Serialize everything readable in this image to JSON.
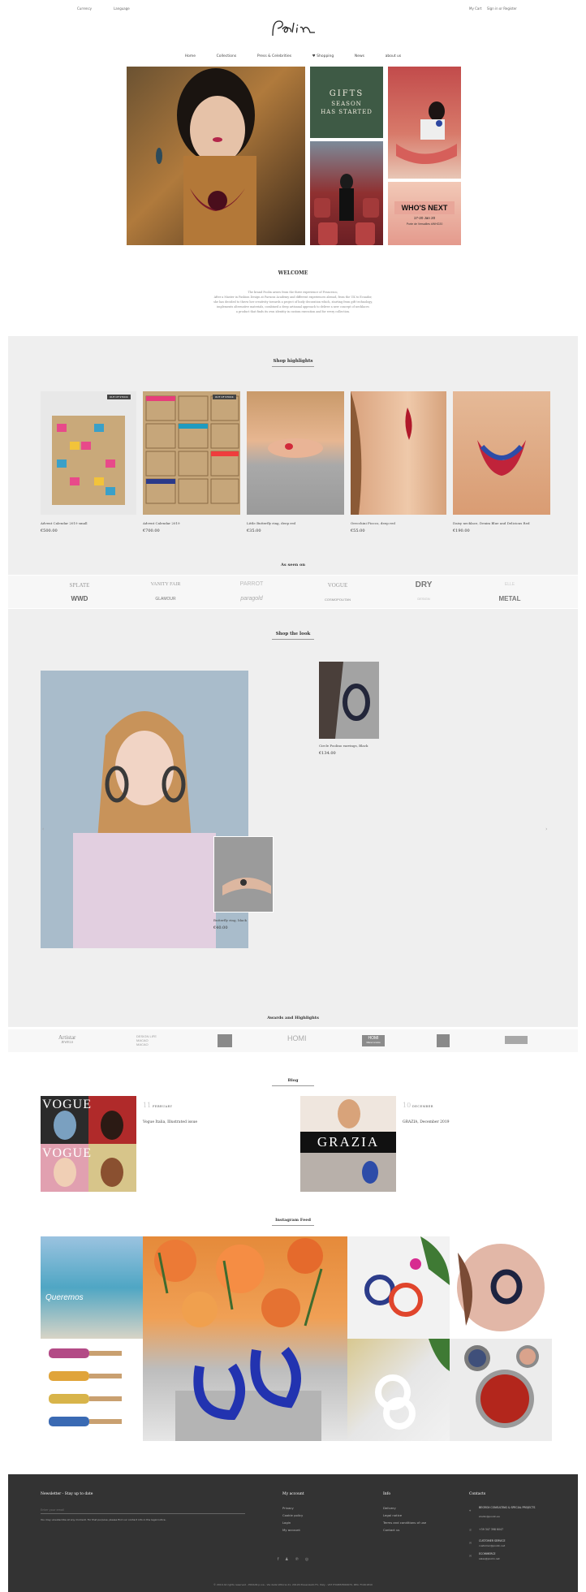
{
  "topbar": {
    "left1": "Currency",
    "left2": "Language",
    "right1": "My Cart",
    "right2": "Sign in or Register"
  },
  "logo": "Poolin",
  "nav": [
    "Home",
    "Collections",
    "Press & Celebrities",
    "♥ Shopping",
    "News",
    "about us"
  ],
  "hero": {
    "gifts_line1": "GIFTS",
    "gifts_line2": "SEASON",
    "gifts_line3": "HAS STARTED",
    "whats_next": "WHO'S NEXT",
    "whats_dates": "17-20 Jan 20",
    "whats_place": "Porte de Versailles #WHO20"
  },
  "welcome": {
    "title": "WELCOME",
    "lines": [
      "The brand Poolin arises from the three experience of Francesco,",
      "After a Master in Fashion Design at Parsons Academy and different experiences abroad, from the UK to Ecuador,",
      "she has decided to throw her creativity towards a project of body decoration which, starting from gift technology,",
      "implements alternative materials, combined a deep artisanal approach to deliver a new concept of necklaces",
      "a product that finds its own identity in custom execution and for every collection."
    ]
  },
  "shop_highlights": {
    "title": "Shop highlights",
    "badge": "OUT OF STOCK",
    "products": [
      {
        "name": "Advent Calendar 2019 small",
        "price": "€500.00"
      },
      {
        "name": "Advent Calendar 2019",
        "price": "€700.00"
      },
      {
        "name": "Little Butterfly ring, deep red",
        "price": "€35.00"
      },
      {
        "name": "Orecchini Fiocco, deep red",
        "price": "€55.00"
      },
      {
        "name": "Daisy necklace, Denim Blue and Delicious Red",
        "price": "€190.00"
      }
    ]
  },
  "as_seen_on": {
    "title": "As seen on",
    "row1": [
      "SPLATE",
      "VANITY FAIR",
      "PARROT",
      "VOGUE",
      "DRY",
      "ELLE"
    ],
    "row2": [
      "WWD",
      "GLAMOUR",
      "paragold",
      "COSMOPOLITAN",
      "DESIGN",
      "METAL"
    ]
  },
  "shop_the_look": {
    "title": "Shop the look",
    "item1": {
      "name": "Circle Poolino earrings, Black",
      "price": "€134.00"
    },
    "item2": {
      "name": "Butterfly ring, black",
      "price": "€40.00"
    },
    "prev": "‹",
    "next": "›"
  },
  "awards": {
    "title": "Awards and Highlights",
    "logos": [
      "Artistar",
      "DESIGN LIFE MACAO",
      "",
      "HOMI",
      "HOMI",
      "",
      ""
    ],
    "artistar_sub": "JEWELS",
    "macao_sub": "MACAO",
    "homi2_sub": "Milano Incontra"
  },
  "blog": {
    "title": "Blog",
    "posts": [
      {
        "day": "11",
        "month": "FEBRUARY",
        "title": "Vogue Italia, Illustrated issue"
      },
      {
        "day": "10",
        "month": "DECEMBER",
        "title": "GRAZIA, December 2019"
      }
    ],
    "grazia": "GRAZIA",
    "vogue": "VOGUE"
  },
  "instagram": {
    "title": "Instagram Feed",
    "graffiti": "Queremos"
  },
  "footer": {
    "newsletter_title": "Newsletter - Stay up to date",
    "newsletter_placeholder": "Enter your email",
    "newsletter_note": "You may unsubscribe at any moment. For that purpose, please find our contact info in the legal notice.",
    "my_account_title": "My account",
    "my_account": [
      "Privacy",
      "Cookie policy",
      "Login",
      "My account"
    ],
    "info_title": "Info",
    "info": [
      "Delivery",
      "Legal notice",
      "Terms and conditions of use",
      "Contact us"
    ],
    "contacts_title": "Contacts",
    "contacts": [
      {
        "icon": "address-icon",
        "text": "BEGROX CONSULTING & SPECIAL PROJECTS"
      },
      {
        "icon": "phone-icon",
        "text": "+39 347 398 6047"
      },
      {
        "icon": "mail-icon",
        "text": "CUSTOMER SERVICE"
      },
      {
        "icon": "mail-icon",
        "text": "ECOMMERCE"
      }
    ],
    "contacts_sub": [
      "studio@poolin.eu",
      "",
      "customer@poolin.net",
      "sales@poolin.net"
    ],
    "copyright": "© 2019 All rights reserved - POOLIN p.iva - Via della Vittoria 21, 20124 Presenzello FC, Italy - VAT IT04853560670, REA: FC401810",
    "social": [
      "f",
      "♟",
      "℗",
      "◎"
    ]
  }
}
